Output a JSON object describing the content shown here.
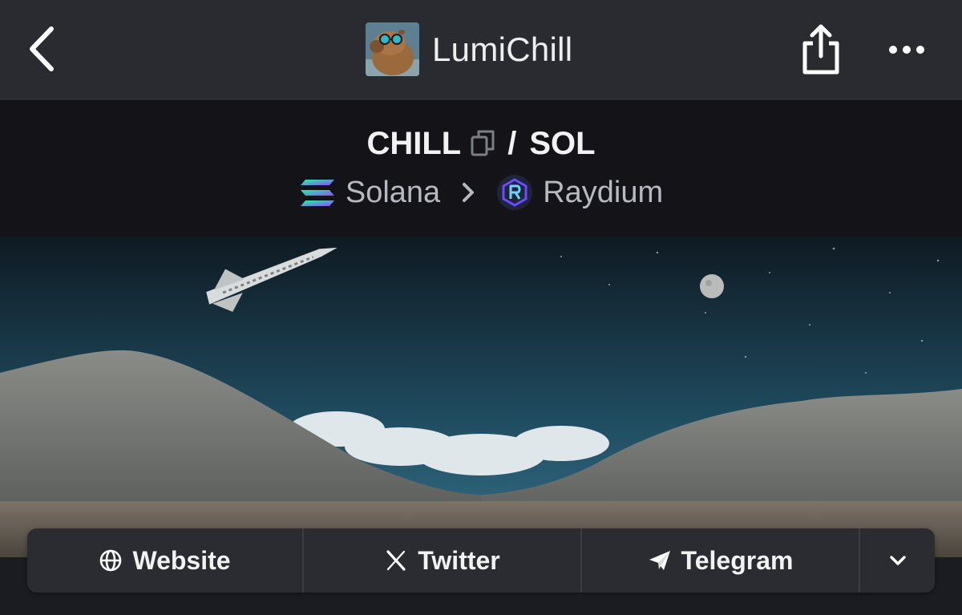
{
  "header": {
    "title": "LumiChill",
    "back_icon": "chevron-left-icon",
    "share_icon": "share-icon",
    "more_icon": "more-horizontal-icon"
  },
  "pair": {
    "base": "CHILL",
    "separator": "/",
    "quote": "SOL",
    "chain": "Solana",
    "dex": "Raydium"
  },
  "links": {
    "website": "Website",
    "twitter": "Twitter",
    "telegram": "Telegram"
  },
  "colors": {
    "topbar_bg": "#2a2b31",
    "pair_bg": "#131318",
    "links_bg": "#2b2c32",
    "muted_text": "#b7b8c0"
  }
}
